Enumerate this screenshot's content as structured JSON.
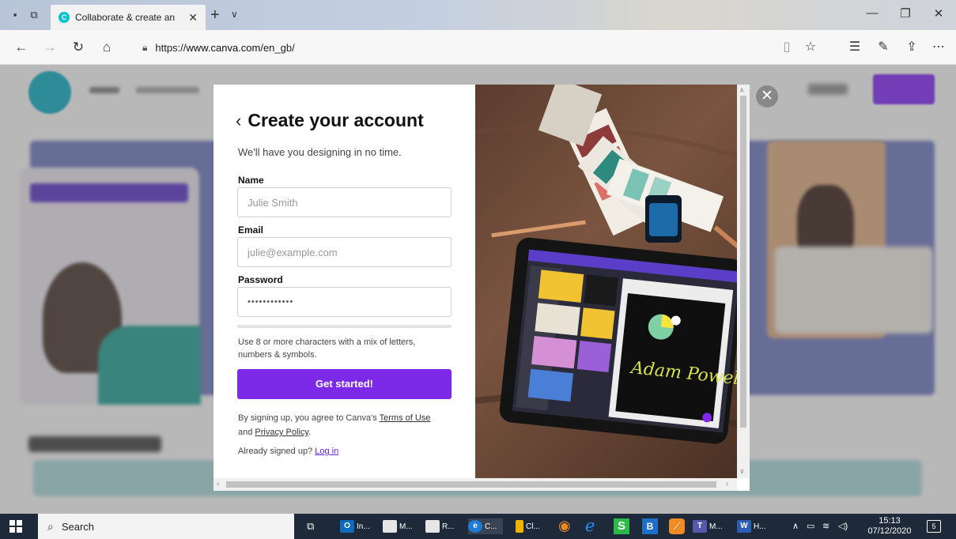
{
  "browser": {
    "tab_title": "Collaborate & create an",
    "tab_favicon": "C",
    "url_prefix": "https://",
    "url_host": "www.canva.com",
    "url_path": "/en_gb/"
  },
  "modal": {
    "title": "Create your account",
    "subtitle": "We'll have you designing in no time.",
    "name_label": "Name",
    "name_placeholder": "Julie Smith",
    "email_label": "Email",
    "email_placeholder": "julie@example.com",
    "password_label": "Password",
    "password_value": "••••••••••••",
    "password_hint": "Use 8 or more characters with a mix of letters, numbers & symbols.",
    "cta_label": "Get started!",
    "terms_prefix": "By signing up, you agree to Canva's",
    "terms_link": "Terms of Use",
    "terms_and": "and",
    "privacy_link": "Privacy Policy",
    "terms_suffix": ".",
    "already_text": "Already signed up?",
    "login_link": "Log in"
  },
  "photo": {
    "tablet_text": "Adam Powell"
  },
  "taskbar": {
    "search_label": "Search",
    "apps": [
      {
        "label": "In...",
        "icon": "O"
      },
      {
        "label": "M...",
        "icon": ""
      },
      {
        "label": "R...",
        "icon": ""
      },
      {
        "label": "C...",
        "icon": "e"
      },
      {
        "label": "Cl...",
        "icon": ""
      },
      {
        "label": "M...",
        "icon": "T"
      },
      {
        "label": "H...",
        "icon": "W"
      }
    ],
    "time": "15:13",
    "date": "07/12/2020",
    "notif_count": "5"
  },
  "colors": {
    "accent": "#7c2ae8",
    "link": "#6a1fd6",
    "canva_teal": "#00c4cc"
  }
}
